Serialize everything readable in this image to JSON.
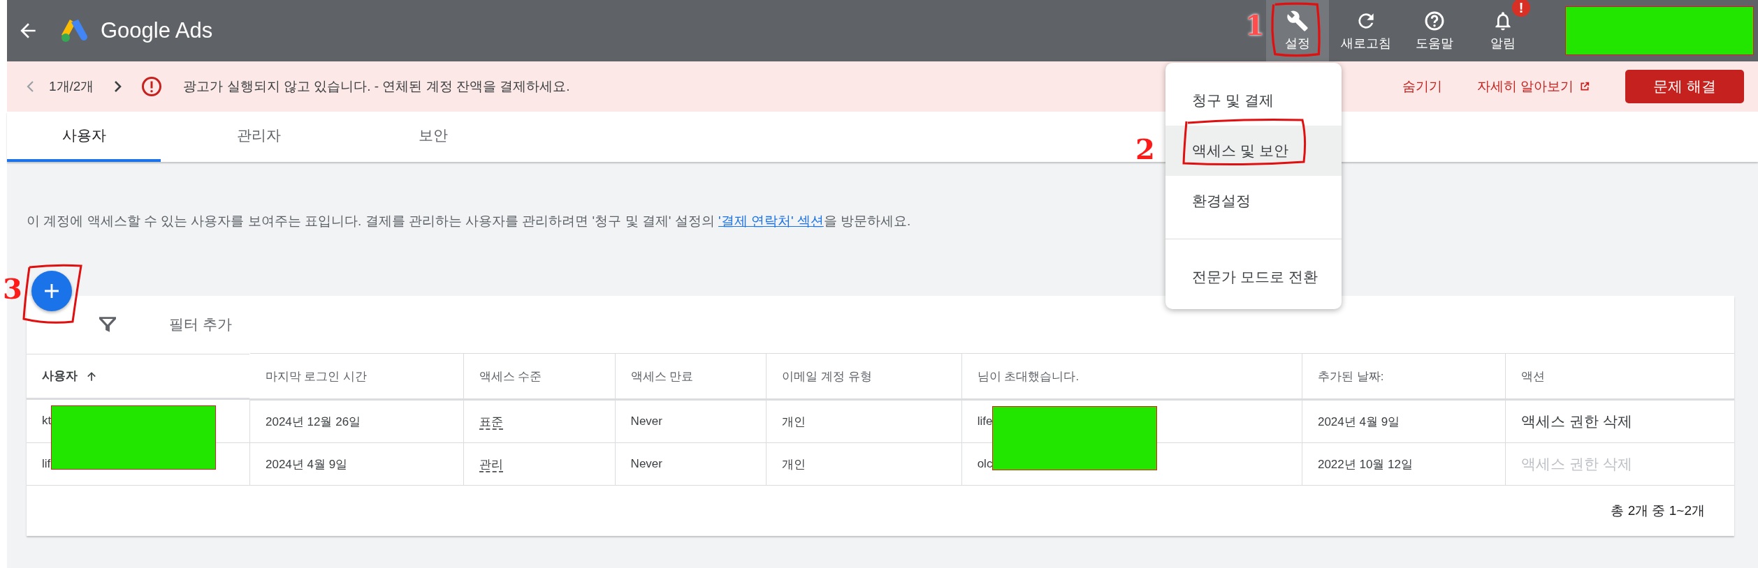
{
  "header": {
    "product": "Google Ads",
    "actions": [
      {
        "kind": "wrench",
        "label": "설정",
        "selected": true
      },
      {
        "kind": "refresh",
        "label": "새로고침",
        "selected": false
      },
      {
        "kind": "help",
        "label": "도움말",
        "selected": false
      },
      {
        "kind": "bell",
        "label": "알림",
        "selected": false,
        "badge": "!"
      }
    ],
    "account_redacted": true
  },
  "banner": {
    "counter": "1개/2개",
    "message": "광고가 실행되지 않고 있습니다. - 연체된 계정 잔액을 결제하세요.",
    "hide": "숨기기",
    "learn_more": "자세히 알아보기",
    "button": "문제 해결"
  },
  "tabs": [
    {
      "label": "사용자",
      "selected": true
    },
    {
      "label": "관리자",
      "selected": false
    },
    {
      "label": "보안",
      "selected": false
    }
  ],
  "description": {
    "text": "이 계정에 액세스할 수 있는 사용자를 보여주는 표입니다. 결제를 관리하는 사용자를 관리하려면 '청구 및 결제' 설정의 ",
    "link": "'결제 연락처' 섹션",
    "after": "을 방문하세요."
  },
  "filter": {
    "placeholder": "필터 추가"
  },
  "table": {
    "columns": [
      {
        "label": "사용자",
        "sorted": true
      },
      {
        "label": "마지막 로그인 시간",
        "sorted": false
      },
      {
        "label": "액세스 수준",
        "sorted": false
      },
      {
        "label": "액세스 만료",
        "sorted": false
      },
      {
        "label": "이메일 계정 유형",
        "sorted": false
      },
      {
        "label": "님이 초대했습니다.",
        "sorted": false
      },
      {
        "label": "추가된 날짜:",
        "sorted": false
      },
      {
        "label": "액션",
        "sorted": false
      }
    ],
    "rows": [
      {
        "user": "kt",
        "user_redacted": true,
        "last_login": "2024년 12월 26일",
        "access_level": "표준",
        "expires": "Never",
        "email_type": "개인",
        "invited_by": "life",
        "invited_redacted": true,
        "added": "2024년 4월 9일",
        "action": "액세스 권한 삭제",
        "action_disabled": false
      },
      {
        "user": "lif",
        "last_login": "2024년 4월 9일",
        "access_level": "관리",
        "expires": "Never",
        "email_type": "개인",
        "invited_by": "olc",
        "added": "2022년 10월 12일",
        "action": "액세스 권한 삭제",
        "action_disabled": true
      }
    ],
    "pagination": "총 2개 중 1~2개"
  },
  "settings_menu": {
    "items": [
      {
        "label": "청구 및 결제",
        "selected": false
      },
      {
        "label": "액세스 및 보안",
        "selected": true
      },
      {
        "label": "환경설정",
        "selected": false
      },
      {
        "label": "전문가 모드로 전환",
        "selected": false,
        "divider_before": true
      }
    ]
  },
  "annotations": [
    {
      "number": "1"
    },
    {
      "number": "2"
    },
    {
      "number": "3"
    }
  ]
}
